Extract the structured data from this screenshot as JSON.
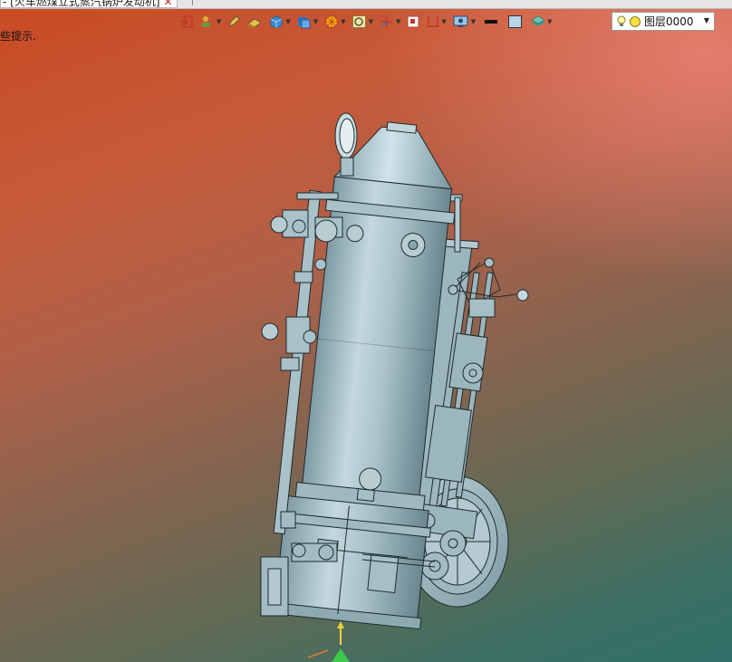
{
  "document_tab": {
    "title": "- [火车燃煤立式蒸汽锅炉发动机]",
    "close_glyph": "✕"
  },
  "status_hint": "些提示.",
  "toolbar": {
    "items": [
      {
        "name": "exit-sketch-icon"
      },
      {
        "name": "point-icon"
      },
      {
        "name": "pencil-icon"
      },
      {
        "name": "eraser-icon"
      },
      {
        "name": "solid-box-icon"
      },
      {
        "name": "render-style-icon"
      },
      {
        "name": "color-wheel-icon"
      },
      {
        "name": "zoom-fit-icon"
      },
      {
        "name": "coordinate-icon"
      },
      {
        "name": "view-frame-icon"
      },
      {
        "name": "section-icon"
      },
      {
        "name": "monitor-icon"
      },
      {
        "name": "line-style-icon"
      },
      {
        "name": "fill-color-icon"
      },
      {
        "name": "layer-stack-icon"
      }
    ]
  },
  "layer_selector": {
    "value": "图层0000"
  },
  "colors": {
    "model": "#a8c4cc",
    "model_dark": "#6f8f98",
    "edge": "#1e2a2e",
    "triad_green": "#3cc84a",
    "triad_yellow": "#f4d23a"
  }
}
